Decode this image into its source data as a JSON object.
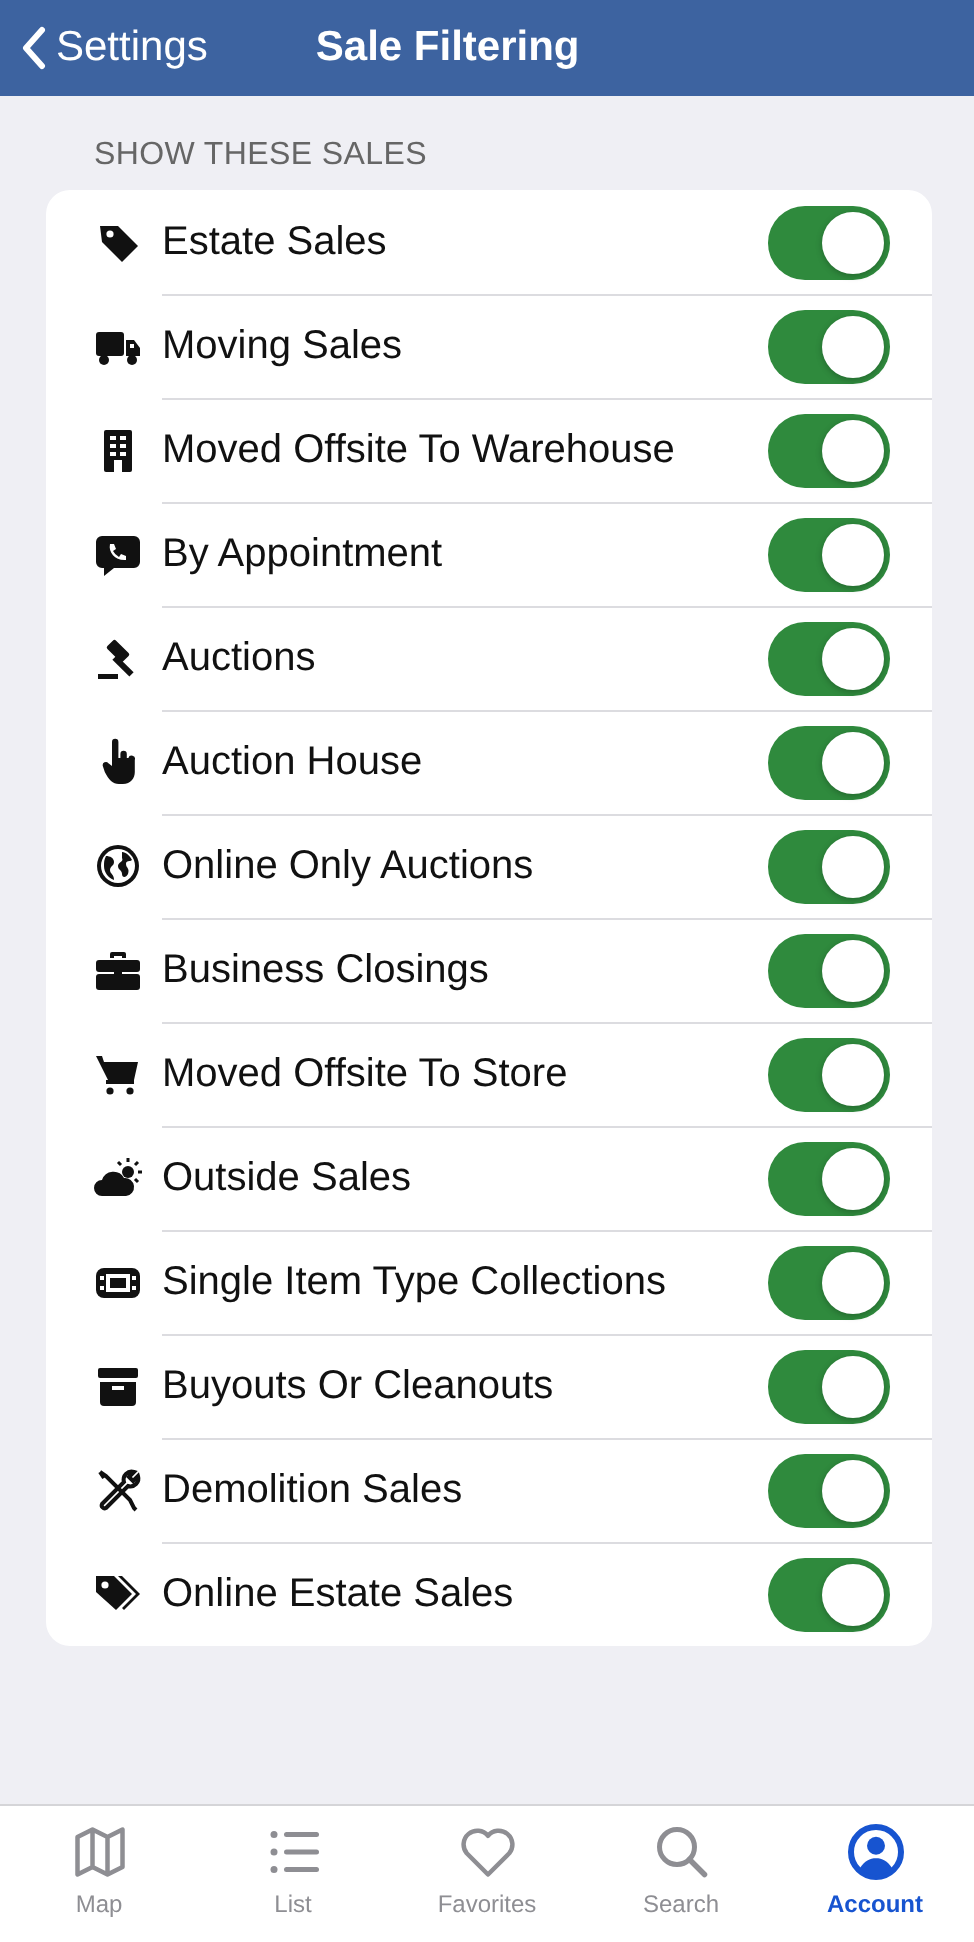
{
  "nav": {
    "back": "Settings",
    "title": "Sale Filtering"
  },
  "section": {
    "header": "SHOW THESE SALES",
    "rows": [
      {
        "label": "Estate Sales",
        "on": true
      },
      {
        "label": "Moving Sales",
        "on": true
      },
      {
        "label": "Moved Offsite To Warehouse",
        "on": true
      },
      {
        "label": "By Appointment",
        "on": true
      },
      {
        "label": "Auctions",
        "on": true
      },
      {
        "label": "Auction House",
        "on": true
      },
      {
        "label": "Online Only Auctions",
        "on": true
      },
      {
        "label": "Business Closings",
        "on": true
      },
      {
        "label": "Moved Offsite To Store",
        "on": true
      },
      {
        "label": "Outside Sales",
        "on": true
      },
      {
        "label": "Single Item Type Collections",
        "on": true
      },
      {
        "label": "Buyouts Or Cleanouts",
        "on": true
      },
      {
        "label": "Demolition Sales",
        "on": true
      },
      {
        "label": "Online Estate Sales",
        "on": true
      }
    ]
  },
  "tab_bar": [
    {
      "label": "Map",
      "selected": false
    },
    {
      "label": "List",
      "selected": false
    },
    {
      "label": "Favorites",
      "selected": false
    },
    {
      "label": "Search",
      "selected": false
    },
    {
      "label": "Account",
      "selected": true
    }
  ]
}
